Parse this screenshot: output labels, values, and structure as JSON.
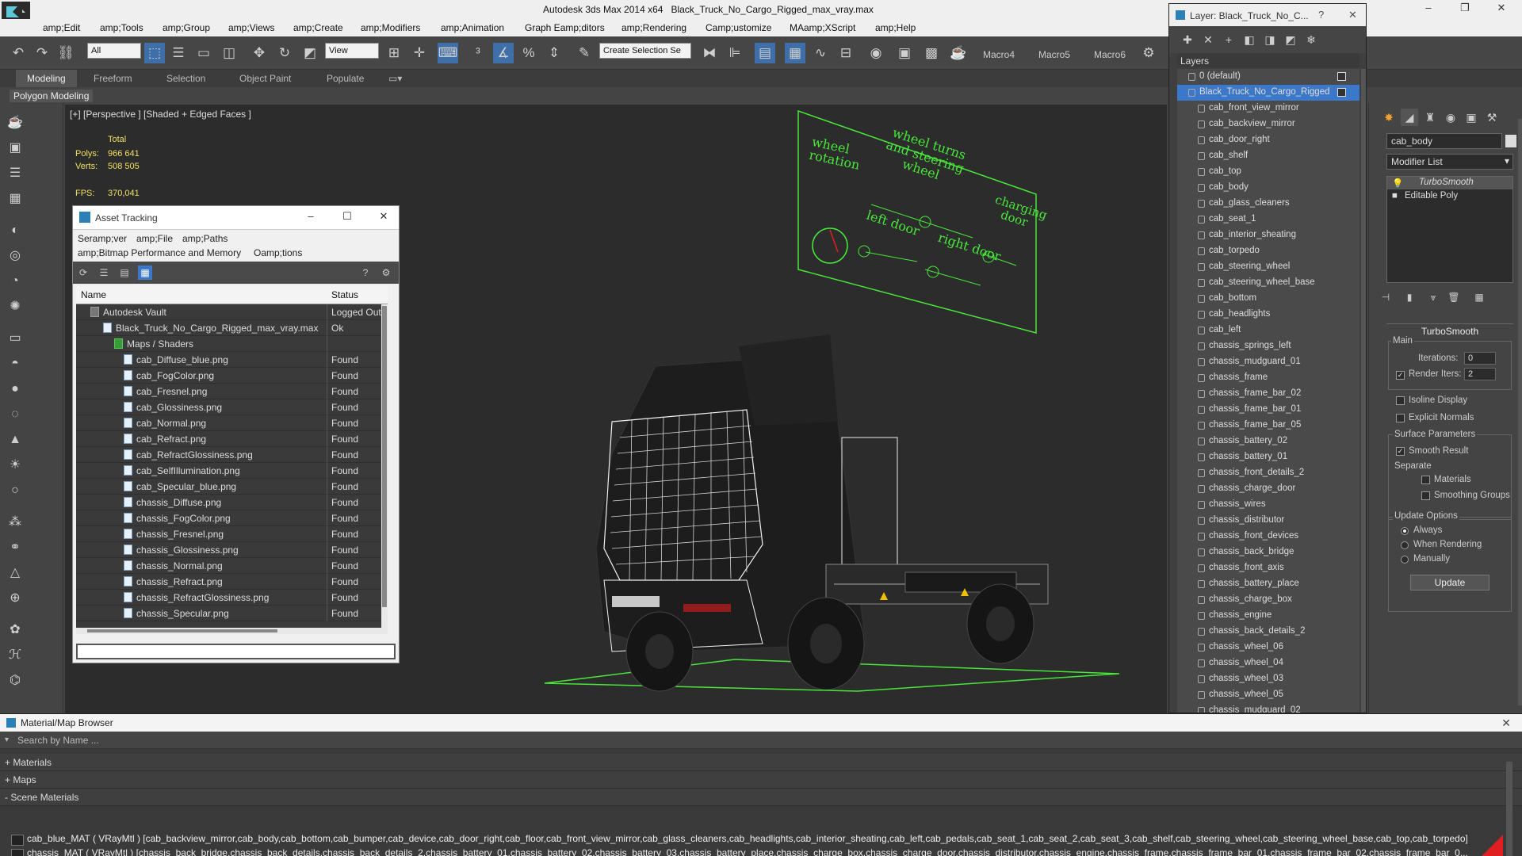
{
  "window": {
    "title_app": "Autodesk 3ds Max  2014 x64",
    "title_file": "Black_Truck_No_Cargo_Rigged_max_vray.max",
    "controls": [
      "–",
      "❐",
      "✕"
    ]
  },
  "menu": [
    "amp;Edit",
    "amp;Tools",
    "amp;Group",
    "amp;Views",
    "amp;Create",
    "amp;Modifiers",
    "amp;Animation",
    "Graph Eamp;ditors",
    "amp;Rendering",
    "Camp;ustomize",
    "MAamp;XScript",
    "amp;Help"
  ],
  "toolbar": {
    "filter_value": "All",
    "view_value": "View",
    "selection_set_placeholder": "Create Selection Se",
    "macros": [
      "Macro4",
      "Macro5",
      "Macro6"
    ]
  },
  "ribbon": {
    "tabs": [
      "Modeling",
      "Freeform",
      "Selection",
      "Object Paint",
      "Populate"
    ],
    "sub_label": "Polygon Modeling"
  },
  "viewport": {
    "label": "[+] [Perspective ] [Shaded + Edged Faces ]",
    "stats": {
      "total_label": "Total",
      "polys_label": "Polys:",
      "polys_value": "966 641",
      "verts_label": "Verts:",
      "verts_value": "508 505",
      "fps_label": "FPS:",
      "fps_value": "370,041"
    },
    "control_panel": {
      "wheel_rotation": "wheel rotation",
      "wheel_turns": "wheel turns and steering wheel",
      "left_door": "left door",
      "right_door": "right door",
      "charging_door": "charging door"
    }
  },
  "asset_tracking": {
    "title": "Asset Tracking",
    "menu": [
      "Seramp;ver",
      "amp;File",
      "amp;Paths",
      "amp;Bitmap Performance and Memory",
      "Oamp;tions"
    ],
    "columns": {
      "name": "Name",
      "status": "Status"
    },
    "rows": [
      {
        "name": "Autodesk Vault",
        "status": "Logged Out",
        "indent": 0
      },
      {
        "name": "Black_Truck_No_Cargo_Rigged_max_vray.max",
        "status": "Ok",
        "indent": 1
      },
      {
        "name": "Maps / Shaders",
        "status": "",
        "indent": 2
      },
      {
        "name": "cab_Diffuse_blue.png",
        "status": "Found",
        "indent": 3
      },
      {
        "name": "cab_FogColor.png",
        "status": "Found",
        "indent": 3
      },
      {
        "name": "cab_Fresnel.png",
        "status": "Found",
        "indent": 3
      },
      {
        "name": "cab_Glossiness.png",
        "status": "Found",
        "indent": 3
      },
      {
        "name": "cab_Normal.png",
        "status": "Found",
        "indent": 3
      },
      {
        "name": "cab_Refract.png",
        "status": "Found",
        "indent": 3
      },
      {
        "name": "cab_RefractGlossiness.png",
        "status": "Found",
        "indent": 3
      },
      {
        "name": "cab_SelfIllumination.png",
        "status": "Found",
        "indent": 3
      },
      {
        "name": "cab_Specular_blue.png",
        "status": "Found",
        "indent": 3
      },
      {
        "name": "chassis_Diffuse.png",
        "status": "Found",
        "indent": 3
      },
      {
        "name": "chassis_FogColor.png",
        "status": "Found",
        "indent": 3
      },
      {
        "name": "chassis_Fresnel.png",
        "status": "Found",
        "indent": 3
      },
      {
        "name": "chassis_Glossiness.png",
        "status": "Found",
        "indent": 3
      },
      {
        "name": "chassis_Normal.png",
        "status": "Found",
        "indent": 3
      },
      {
        "name": "chassis_Refract.png",
        "status": "Found",
        "indent": 3
      },
      {
        "name": "chassis_RefractGlossiness.png",
        "status": "Found",
        "indent": 3
      },
      {
        "name": "chassis_Specular.png",
        "status": "Found",
        "indent": 3
      }
    ]
  },
  "layers": {
    "title": "Layer: Black_Truck_No_C...",
    "help": "?",
    "close": "✕",
    "header": "Layers",
    "items": [
      {
        "name": "0 (default)",
        "type": "layer",
        "selected": false
      },
      {
        "name": "Black_Truck_No_Cargo_Rigged",
        "type": "layer",
        "selected": true
      },
      {
        "name": "cab_front_view_mirror",
        "type": "object"
      },
      {
        "name": "cab_backview_mirror",
        "type": "object"
      },
      {
        "name": "cab_door_right",
        "type": "object"
      },
      {
        "name": "cab_shelf",
        "type": "object"
      },
      {
        "name": "cab_top",
        "type": "object"
      },
      {
        "name": "cab_body",
        "type": "object"
      },
      {
        "name": "cab_glass_cleaners",
        "type": "object"
      },
      {
        "name": "cab_seat_1",
        "type": "object"
      },
      {
        "name": "cab_interior_sheating",
        "type": "object"
      },
      {
        "name": "cab_torpedo",
        "type": "object"
      },
      {
        "name": "cab_steering_wheel",
        "type": "object"
      },
      {
        "name": "cab_steering_wheel_base",
        "type": "object"
      },
      {
        "name": "cab_bottom",
        "type": "object"
      },
      {
        "name": "cab_headlights",
        "type": "object"
      },
      {
        "name": "cab_left",
        "type": "object"
      },
      {
        "name": "chassis_springs_left",
        "type": "object"
      },
      {
        "name": "chassis_mudguard_01",
        "type": "object"
      },
      {
        "name": "chassis_frame",
        "type": "object"
      },
      {
        "name": "chassis_frame_bar_02",
        "type": "object"
      },
      {
        "name": "chassis_frame_bar_01",
        "type": "object"
      },
      {
        "name": "chassis_frame_bar_05",
        "type": "object"
      },
      {
        "name": "chassis_battery_02",
        "type": "object"
      },
      {
        "name": "chassis_battery_01",
        "type": "object"
      },
      {
        "name": "chassis_front_details_2",
        "type": "object"
      },
      {
        "name": "chassis_charge_door",
        "type": "object"
      },
      {
        "name": "chassis_wires",
        "type": "object"
      },
      {
        "name": "chassis_distributor",
        "type": "object"
      },
      {
        "name": "chassis_front_devices",
        "type": "object"
      },
      {
        "name": "chassis_back_bridge",
        "type": "object"
      },
      {
        "name": "chassis_front_axis",
        "type": "object"
      },
      {
        "name": "chassis_battery_place",
        "type": "object"
      },
      {
        "name": "chassis_charge_box",
        "type": "object"
      },
      {
        "name": "chassis_engine",
        "type": "object"
      },
      {
        "name": "chassis_back_details_2",
        "type": "object"
      },
      {
        "name": "chassis_wheel_06",
        "type": "object"
      },
      {
        "name": "chassis_wheel_04",
        "type": "object"
      },
      {
        "name": "chassis_wheel_03",
        "type": "object"
      },
      {
        "name": "chassis_wheel_05",
        "type": "object"
      },
      {
        "name": "chassis_mudguard_02",
        "type": "object"
      }
    ]
  },
  "command_panel": {
    "object_name": "cab_body",
    "modifier_list": "Modifier List",
    "stack": [
      "TurboSmooth",
      "Editable Poly"
    ],
    "turbosmooth": {
      "title": "TurboSmooth",
      "main": "Main",
      "iterations_label": "Iterations:",
      "iterations_value": "0",
      "render_iters_label": "Render Iters:",
      "render_iters_value": "2",
      "isoline": "Isoline Display",
      "explicit_normals": "Explicit Normals",
      "surface_params": "Surface Parameters",
      "smooth_result": "Smooth Result",
      "separate": "Separate",
      "materials": "Materials",
      "smoothing_groups": "Smoothing Groups",
      "update_options": "Update Options",
      "always": "Always",
      "when_rendering": "When Rendering",
      "manually": "Manually",
      "update_button": "Update"
    }
  },
  "material_browser": {
    "title": "Material/Map Browser",
    "search_placeholder": "Search by Name ...",
    "categories": [
      "+ Materials",
      "+ Maps",
      "- Scene Materials"
    ],
    "scene_materials": [
      "cab_blue_MAT ( VRayMtl ) [cab_backview_mirror,cab_body,cab_bottom,cab_bumper,cab_device,cab_door_right,cab_floor,cab_front_view_mirror,cab_glass_cleaners,cab_headlights,cab_interior_sheating,cab_left,cab_pedals,cab_seat_1,cab_seat_2,cab_seat_3,cab_shelf,cab_steering_wheel,cab_steering_wheel_base,cab_top,cab_torpedo]",
      "chassis_MAT ( VRayMtl ) [chassis_back_bridge,chassis_back_details,chassis_back_details_2,chassis_battery_01,chassis_battery_02,chassis_battery_03,chassis_battery_place,chassis_charge_box,chassis_charge_door,chassis_distributor,chassis_engine,chassis_frame,chassis_frame_bar_01,chassis_frame_bar_02,chassis_frame_bar_0..."
    ]
  },
  "colors": {
    "accent": "#3b78c9",
    "wire_green": "#48e83a",
    "stat_yellow": "#f0e060"
  }
}
